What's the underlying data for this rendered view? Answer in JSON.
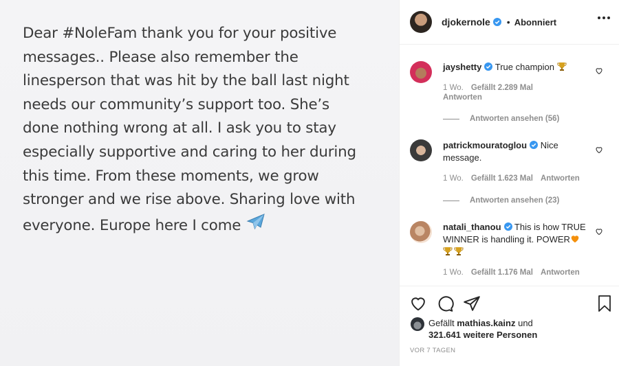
{
  "post": {
    "text": "Dear #NoleFam thank you for your positive\nmessages.. Please also remember the\nlinesperson that was hit by the ball last night\nneeds our community’s support too. She’s\ndone nothing wrong at all. I ask you to stay\nespecially supportive and caring to her during\nthis time. From these moments, we grow\nstronger and we rise above. Sharing love with\neveryone. Europe here I come ",
    "emoji": "airplane-icon"
  },
  "header": {
    "username": "djokernole",
    "separator": "•",
    "follow_status": "Abonniert"
  },
  "comments": [
    {
      "username": "jayshetty",
      "text": "True champion",
      "emoji": "trophy",
      "age": "1 Wo.",
      "likes": "Gefällt 2.289 Mal",
      "reply": "Antworten",
      "view_replies": "Antworten ansehen (56)"
    },
    {
      "username": "patrickmouratoglou",
      "text": "Nice message.",
      "age": "1 Wo.",
      "likes": "Gefällt 1.623 Mal",
      "reply": "Antworten",
      "view_replies": "Antworten ansehen (23)"
    },
    {
      "username": "natali_thanou",
      "text": "This is how TRUE WINNER is handling it. POWER",
      "emoji": "orange-heart trophy trophy",
      "age": "1 Wo.",
      "likes": "Gefällt 1.176 Mal",
      "reply": "Antworten"
    }
  ],
  "likes": {
    "prefix": "Gefällt",
    "user": "mathias.kainz",
    "connector": "und",
    "count": "321.641 weitere Personen"
  },
  "timestamp": "VOR 7 TAGEN",
  "colors": {
    "verified": "#3897f0",
    "text": "#262626",
    "muted": "#8e8e8e"
  }
}
